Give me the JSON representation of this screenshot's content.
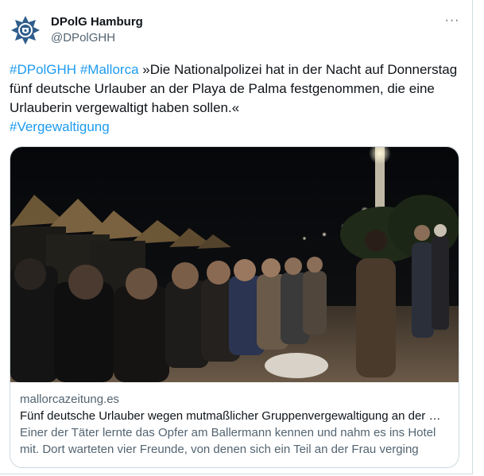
{
  "author": {
    "display_name": "DPolG Hamburg",
    "handle": "@DPolGHH",
    "avatar_icon": "police-star-emblem-icon"
  },
  "more_icon": "ellipsis-icon",
  "more_label": "···",
  "tweet": {
    "hashtag_1": "#DPolGHH",
    "hashtag_2": "#Mallorca",
    "body": "»Die Nationalpolizei hat in der Nacht auf Donnerstag fünf deutsche Urlauber an der Playa de Palma festgenommen, die eine Urlauberin vergewaltigt haben sollen.«",
    "hashtag_3": "#Vergewaltigung"
  },
  "card": {
    "image_icon": "night-promenade-photo",
    "domain": "mallorcazeitung.es",
    "title": "Fünf deutsche Urlauber wegen mutmaßlicher Gruppenvergewaltigung an der …",
    "description": "Einer der Täter lernte das Opfer am Ballermann kennen und nahm es ins Hotel mit. Dort warteten vier Freunde, von denen sich ein Teil an der Frau verging"
  },
  "colors": {
    "link": "#1d9bf0",
    "text": "#0f1419",
    "secondary": "#536471",
    "border": "#cfd9de"
  }
}
